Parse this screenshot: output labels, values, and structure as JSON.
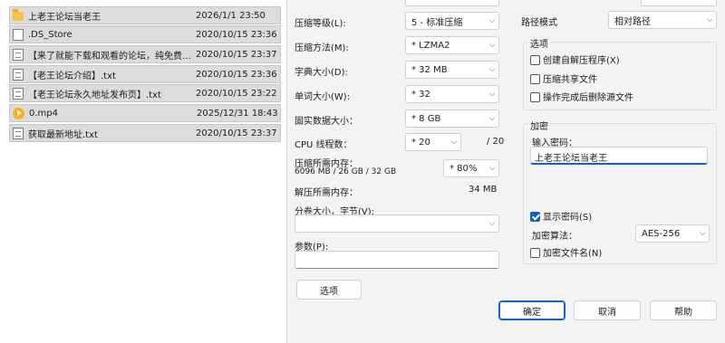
{
  "files": [
    {
      "name": "上老王论坛当老王",
      "date": "2026/1/1 23:50",
      "icon": "folder-icon"
    },
    {
      "name": ".DS_Store",
      "date": "2020/10/15 23:36",
      "icon": "file-icon"
    },
    {
      "name": "【来了就能下载和观看的论坛，纯免费！...",
      "date": "2020/10/15 23:37",
      "icon": "text-file-icon"
    },
    {
      "name": "【老王论坛介绍】.txt",
      "date": "2020/10/15 23:36",
      "icon": "text-file-icon"
    },
    {
      "name": "【老王论坛永久地址发布页】.txt",
      "date": "2020/10/15 23:22",
      "icon": "text-file-icon"
    },
    {
      "name": "0.mp4",
      "date": "2025/12/31 18:43",
      "icon": "video-file-icon"
    },
    {
      "name": "获取最新地址.txt",
      "date": "2020/10/15 23:37",
      "icon": "text-file-icon"
    }
  ],
  "dialog": {
    "level_label": "压缩等级(L):",
    "level_value": "5 - 标准压缩",
    "method_label": "压缩方法(M):",
    "method_value": "* LZMA2",
    "dict_label": "字典大小(D):",
    "dict_value": "* 32 MB",
    "word_label": "单词大小(W):",
    "word_value": "* 32",
    "solid_label": "固实数据大小：",
    "solid_value": "* 8 GB",
    "cpu_label": "CPU 线程数：",
    "cpu_value": "* 20",
    "cpu_max": "/ 20",
    "mem_comp_label": "压缩所需内存：",
    "mem_comp_detail": "6096 MB / 26 GB / 32 GB",
    "mem_comp_value": "* 80%",
    "mem_decomp_label": "解压所需内存：",
    "mem_decomp_value": "34 MB",
    "split_label": "分卷大小，字节(V):",
    "split_value": "",
    "params_label": "参数(P):",
    "params_value": "",
    "options_button": "选项",
    "path_mode_label": "路径模式",
    "path_mode_value": "相对路径",
    "options_title": "选项",
    "opt_sfx": "创建自解压程序(X)",
    "opt_shared": "压缩共享文件",
    "opt_delete": "操作完成后删除源文件",
    "enc_title": "加密",
    "enc_password_label": "输入密码：",
    "enc_password_value": "上老王论坛当老王",
    "show_password": "显示密码(S)",
    "enc_method_label": "加密算法：",
    "enc_method_value": "AES-256",
    "enc_names": "加密文件名(N)",
    "ok": "确定",
    "cancel": "取消",
    "help": "帮助"
  }
}
